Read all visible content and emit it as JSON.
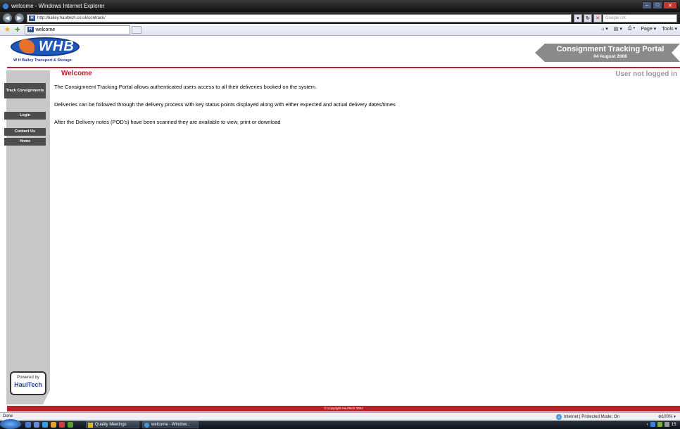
{
  "window": {
    "title": "welcome - Windows Internet Explorer",
    "url": "http://bailey.haultech.co.uk/contrack/",
    "search_placeholder": "Google UK"
  },
  "browser": {
    "tab_label": "welcome",
    "commands": {
      "page": "Page ▾",
      "tools": "Tools ▾"
    },
    "status": {
      "done": "Done",
      "zone": "Internet | Protected Mode: On",
      "zoom": "100% ▾"
    }
  },
  "header": {
    "logo_text": "WHB",
    "logo_subtitle": "W H Bailey Transport & Storage",
    "portal_title": "Consignment Tracking Portal",
    "portal_date": "04 August 2008"
  },
  "sidebar": {
    "items": [
      {
        "label": "Track Consignments"
      },
      {
        "label": "Login"
      },
      {
        "label": "Contact Us"
      },
      {
        "label": "Home"
      }
    ],
    "powered_by": "Powered by",
    "brand": "HaulTech"
  },
  "main": {
    "title": "Welcome",
    "login_status": "User not logged in",
    "paragraphs": [
      "The Consignment Tracking Portal allows authenticated users access to all their deliveries booked on the system.",
      "Deliveries can be followed through the delivery process with key status points displayed along with either expected and actual delivery dates/times",
      "After the Delivery notes (POD's) have been scanned they are available to view, print or download"
    ]
  },
  "footer": {
    "copyright": "© Copyright HaulTech 2004"
  },
  "taskbar": {
    "tasks": [
      {
        "label": "Quality Meetings"
      },
      {
        "label": "welcome - Window..."
      }
    ],
    "clock": "15:"
  },
  "colors": {
    "brand_red": "#b9202a",
    "brand_blue": "#1e57b8",
    "sidebar_grey": "#c8c8c8",
    "button_grey": "#4d4d4d"
  }
}
